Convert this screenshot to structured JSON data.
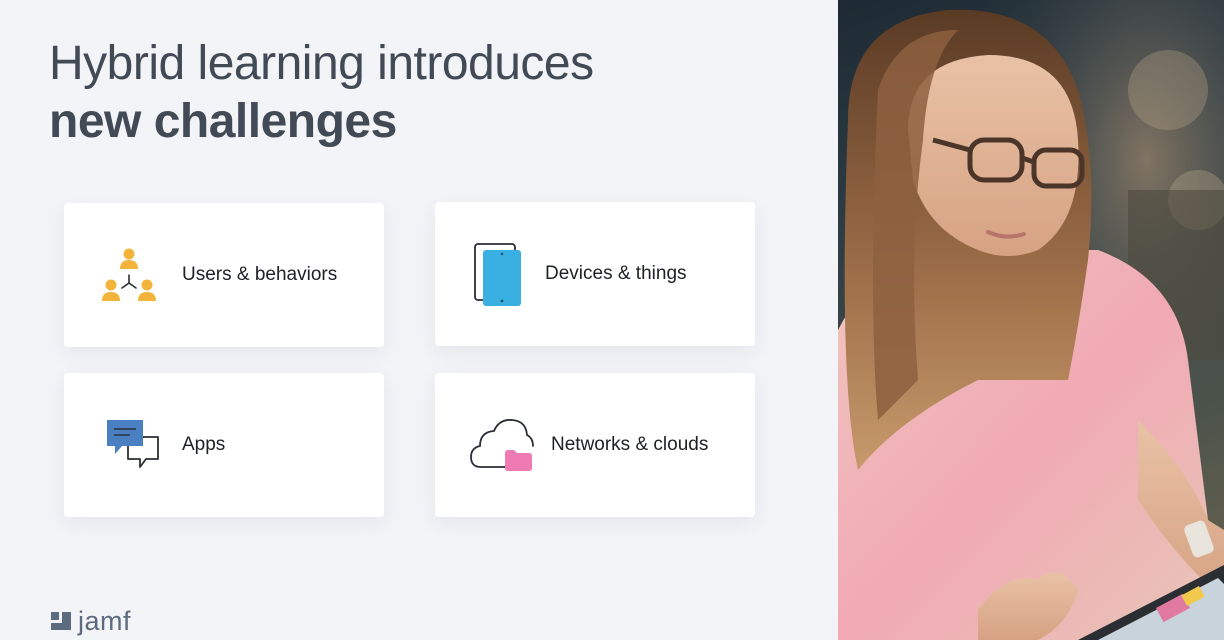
{
  "heading": {
    "line1": "Hybrid learning introduces",
    "line2": "new challenges"
  },
  "cards": [
    {
      "label": "Users & behaviors",
      "icon": "users-network-icon",
      "color": "#f2b43a"
    },
    {
      "label": "Devices & things",
      "icon": "tablet-device-icon",
      "color": "#3ab0e2"
    },
    {
      "label": "Apps",
      "icon": "chat-bubbles-icon",
      "color": "#4a7fc1"
    },
    {
      "label": "Networks & clouds",
      "icon": "cloud-folder-icon",
      "color": "#f07ab3"
    }
  ],
  "brand": {
    "wordmark": "jamf",
    "logo_icon": "jamf-logo-icon",
    "color": "#5c6b80"
  },
  "photo": {
    "icon": "woman-with-tablet-photo"
  }
}
